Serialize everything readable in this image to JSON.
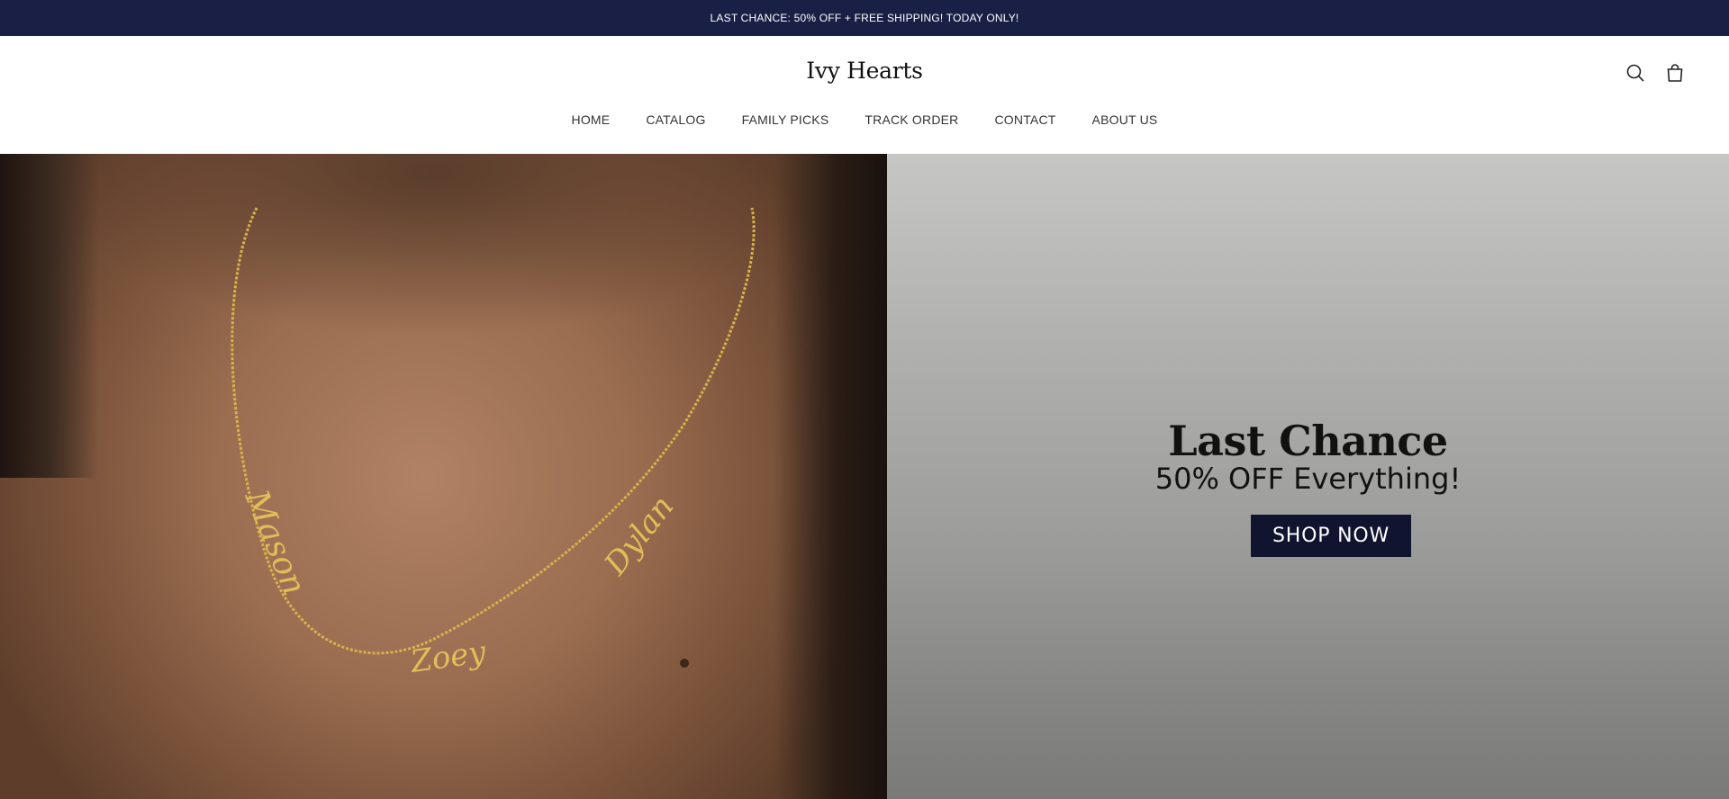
{
  "announcement": {
    "text": "LAST CHANCE: 50% OFF + FREE SHIPPING! TODAY ONLY!"
  },
  "header": {
    "logo": "Ivy Hearts",
    "icons": {
      "search": "search-icon",
      "cart": "shopping-bag-icon"
    }
  },
  "nav": {
    "items": [
      {
        "label": "HOME"
      },
      {
        "label": "CATALOG"
      },
      {
        "label": "FAMILY PICKS"
      },
      {
        "label": "TRACK ORDER"
      },
      {
        "label": "CONTACT"
      },
      {
        "label": "ABOUT US"
      }
    ]
  },
  "hero": {
    "necklace_names": [
      "Mason",
      "Zoey",
      "Dylan"
    ],
    "title": "Last Chance",
    "subtitle": "50% OFF Everything!",
    "cta_label": "SHOP NOW"
  },
  "colors": {
    "announcement_bg": "#1a1f45",
    "cta_bg": "#10142e",
    "necklace_gold": "#d9b24a"
  }
}
